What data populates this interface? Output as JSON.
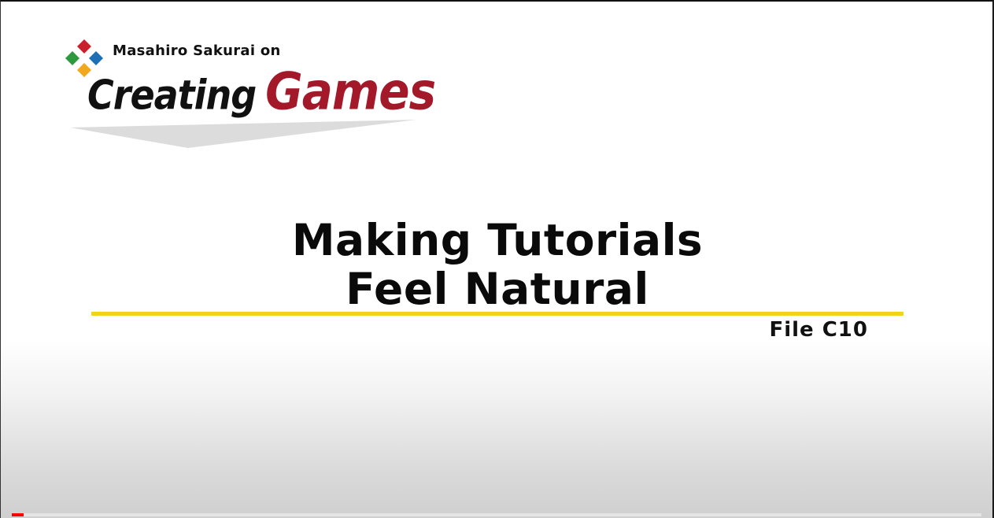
{
  "video": {
    "series_prefix": "Masahiro Sakurai on",
    "series_word1": "Creating",
    "series_word2": "Games",
    "title_line1": "Making Tutorials",
    "title_line2": "Feel Natural",
    "file_label": "File C10",
    "progress_fraction": 0.012
  },
  "colors": {
    "accent_red": "#a3192a",
    "underline_yellow": "#f3d21a",
    "logo_red": "#c8202c",
    "logo_green": "#2e9a3e",
    "logo_blue": "#1f6fb5",
    "logo_yellow": "#f2a81d",
    "progress_red": "#ff0000"
  },
  "icons": {
    "logo": "dpad-logo-icon"
  }
}
